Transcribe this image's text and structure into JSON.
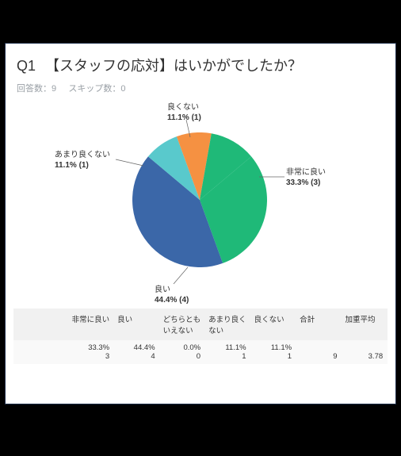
{
  "question": {
    "number": "Q1",
    "title": "【スタッフの応対】はいかがでしたか？",
    "responses_label": "回答数：",
    "responses": "9",
    "skips_label": "スキップ数：",
    "skips": "0"
  },
  "chart_data": {
    "type": "pie",
    "title": "",
    "categories": [
      "非常に良い",
      "良い",
      "どちらともいえない",
      "あまり良くない",
      "良くない"
    ],
    "values": [
      33.3,
      44.4,
      0.0,
      11.1,
      11.1
    ],
    "counts": [
      3,
      4,
      0,
      1,
      1
    ],
    "colors": [
      "#1fb978",
      "#3b67a8",
      "#cccccc",
      "#59c9cc",
      "#f59142"
    ]
  },
  "labels": {
    "very_good_name": "非常に良い",
    "very_good_pct": "33.3% (3)",
    "good_name": "良い",
    "good_pct": "44.4% (4)",
    "not_so_good_name": "あまり良くない",
    "not_so_good_pct": "11.1% (1)",
    "bad_name": "良くない",
    "bad_pct": "11.1% (1)"
  },
  "table": {
    "headers": [
      "",
      "非常に良い",
      "良い",
      "どちらともいえない",
      "あまり良くない",
      "良くない",
      "合計",
      "加重平均"
    ],
    "row": {
      "very_good_pct": "33.3%",
      "very_good_cnt": "3",
      "good_pct": "44.4%",
      "good_cnt": "4",
      "neutral_pct": "0.0%",
      "neutral_cnt": "0",
      "not_so_good_pct": "11.1%",
      "not_so_good_cnt": "1",
      "bad_pct": "11.1%",
      "bad_cnt": "1",
      "total": "9",
      "weighted": "3.78"
    }
  }
}
